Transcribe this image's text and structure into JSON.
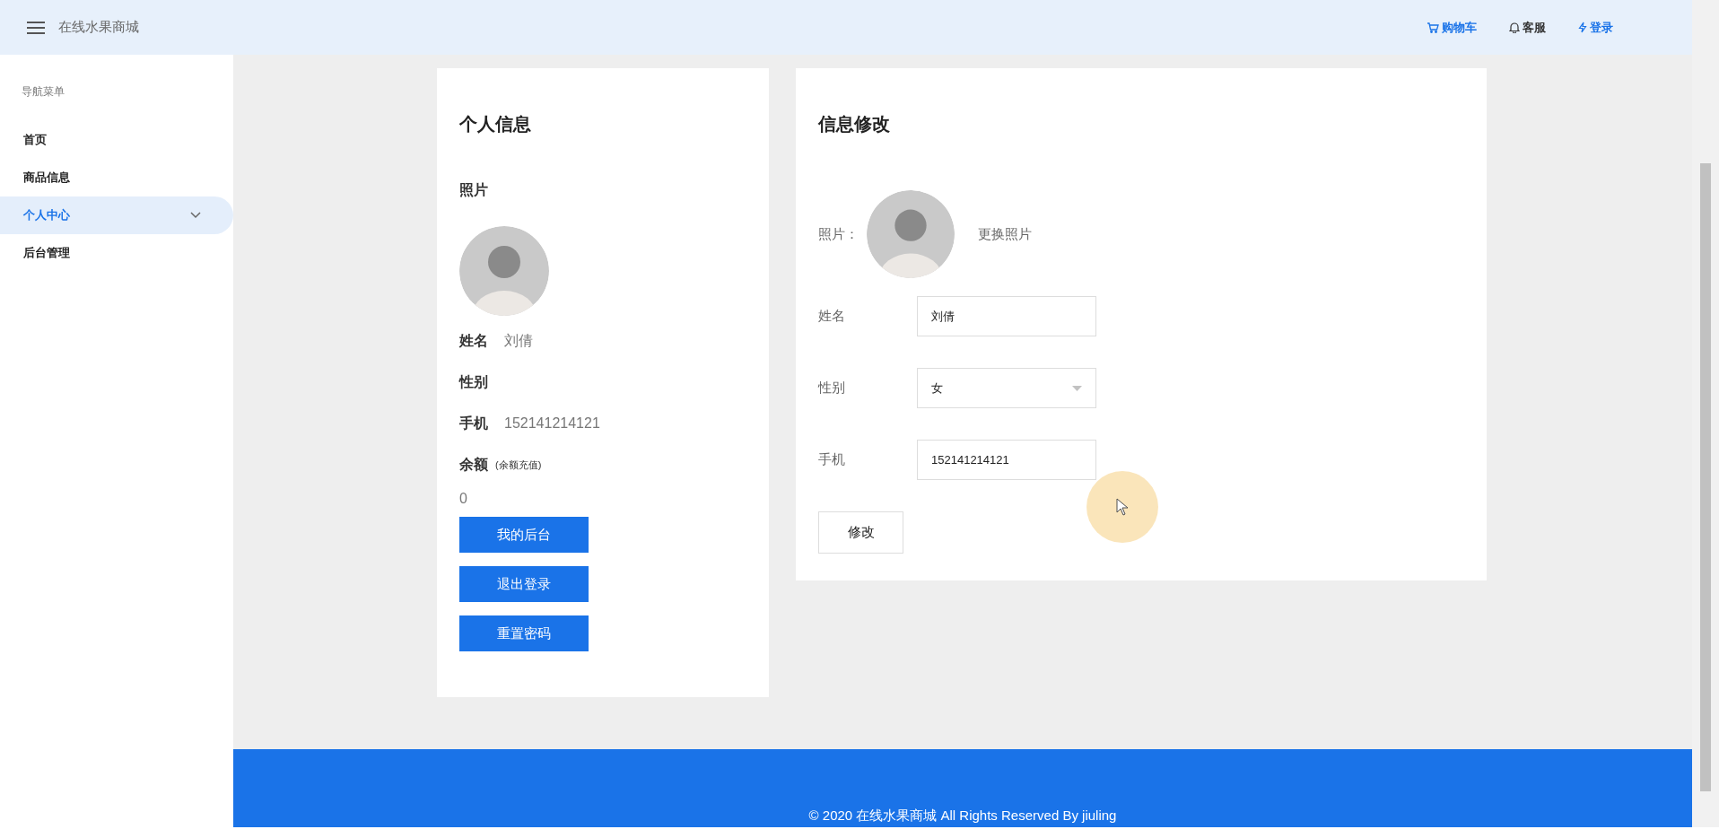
{
  "header": {
    "title": "在线水果商城",
    "links": [
      {
        "kind": "cart",
        "label": "购物车",
        "color": "#1a73e8"
      },
      {
        "kind": "bell",
        "label": "客服",
        "color": "#333333"
      },
      {
        "kind": "bolt",
        "label": "登录",
        "color": "#1a73e8"
      }
    ]
  },
  "sidebar": {
    "heading": "导航菜单",
    "items": [
      {
        "label": "首页",
        "selected": false,
        "kind": "link"
      },
      {
        "label": "商品信息",
        "selected": false,
        "kind": "link"
      },
      {
        "label": "个人中心",
        "selected": true,
        "kind": "submenu"
      },
      {
        "label": "后台管理",
        "selected": false,
        "kind": "link"
      }
    ]
  },
  "profile": {
    "title": "个人信息",
    "photo_label": "照片",
    "fields": [
      {
        "label": "姓名",
        "value": "刘倩"
      },
      {
        "label": "性别"
      },
      {
        "label": "手机",
        "value": "152141214121"
      }
    ],
    "balance_label": "余额",
    "recharge_link": "(余额充值)",
    "balance": "0",
    "buttons": [
      "我的后台",
      "退出登录",
      "重置密码"
    ]
  },
  "edit": {
    "title": "信息修改",
    "photo_label": "照片：",
    "change_photo": "更换照片",
    "fields": [
      {
        "kind": "input",
        "label": "姓名",
        "value": "刘倩"
      },
      {
        "kind": "select",
        "label": "性别",
        "value": "女"
      },
      {
        "kind": "input",
        "label": "手机",
        "value": "152141214121"
      }
    ],
    "submit": "修改"
  },
  "footer": {
    "text": "© 2020 在线水果商城 All Rights Reserved By jiuling"
  }
}
